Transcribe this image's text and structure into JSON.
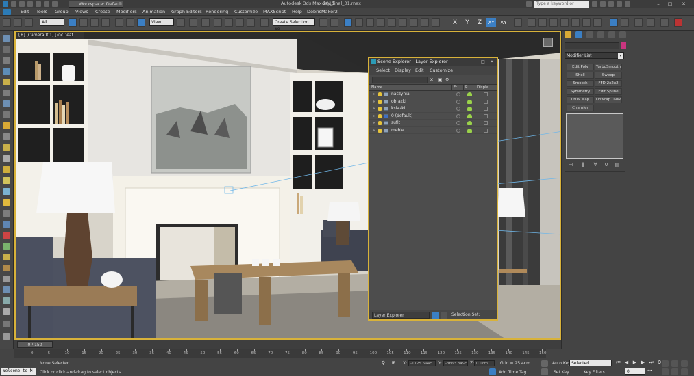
{
  "titlebar": {
    "workspace": "Workspace: Default",
    "app": "Autodesk 3ds Max 2015",
    "file": "day_final_01.max",
    "search_placeholder": "Type a keyword or phrase"
  },
  "menu": [
    "Edit",
    "Tools",
    "Group",
    "Views",
    "Create",
    "Modifiers",
    "Animation",
    "Graph Editors",
    "Rendering",
    "Customize",
    "MAXScript",
    "Help",
    "DebrisMaker2"
  ],
  "toolbar": {
    "filter_value": "All",
    "refcoord_value": "View",
    "selection_set_value": "Create Selection Se",
    "axes": [
      "X",
      "Y",
      "Z",
      "XY",
      "XY"
    ]
  },
  "viewport": {
    "label": "[+] [Camera001] [<<Deat"
  },
  "scene_explorer": {
    "title": "Scene Explorer - Layer Explorer",
    "menu": [
      "Select",
      "Display",
      "Edit",
      "Customize"
    ],
    "columns": [
      "Name",
      "Fr...",
      "R...",
      "Displa..."
    ],
    "layers": [
      {
        "name": "naczynia",
        "default": false
      },
      {
        "name": "obrazki",
        "default": false
      },
      {
        "name": "ksiazki",
        "default": false
      },
      {
        "name": "0 (default)",
        "default": true
      },
      {
        "name": "sufit",
        "default": false
      },
      {
        "name": "meble",
        "default": false
      }
    ],
    "footer_select": "Layer Explorer",
    "selection_set_label": "Selection Set:"
  },
  "command_panel": {
    "modifier_list": "Modifier List",
    "buttons": [
      "Edit Poly",
      "TurboSmooth",
      "Shell",
      "Sweep",
      "Smooth",
      "FFD 2x2x2",
      "Symmetry",
      "Edit Spline",
      "UVW Map",
      "Unwrap UVW",
      "Chamfer"
    ]
  },
  "timeline": {
    "frame_counter": "0 / 150",
    "ticks": [
      "0",
      "5",
      "10",
      "15",
      "20",
      "25",
      "30",
      "35",
      "40",
      "45",
      "50",
      "55",
      "60",
      "65",
      "70",
      "75",
      "80",
      "85",
      "90",
      "95",
      "100",
      "105",
      "110",
      "115",
      "120",
      "125",
      "130",
      "135",
      "140",
      "145",
      "150"
    ]
  },
  "status": {
    "welcome": "Welcome to M",
    "selection": "None Selected",
    "prompt": "Click or click-and-drag to select objects",
    "x_label": "X:",
    "x_value": "-1125.694c",
    "y_label": "Y:",
    "y_value": "-3663.849c",
    "z_label": "Z:",
    "z_value": "0.0cm",
    "grid": "Grid = 25.4cm",
    "add_time_tag": "Add Time Tag",
    "auto_key": "Auto Key",
    "set_key": "Set Key",
    "selected_value": "Selected",
    "key_filters": "Key Filters...",
    "frame_value": "0"
  },
  "colors": {
    "active_viewport": "#d8b23a",
    "accent": "#3b7fc4"
  }
}
